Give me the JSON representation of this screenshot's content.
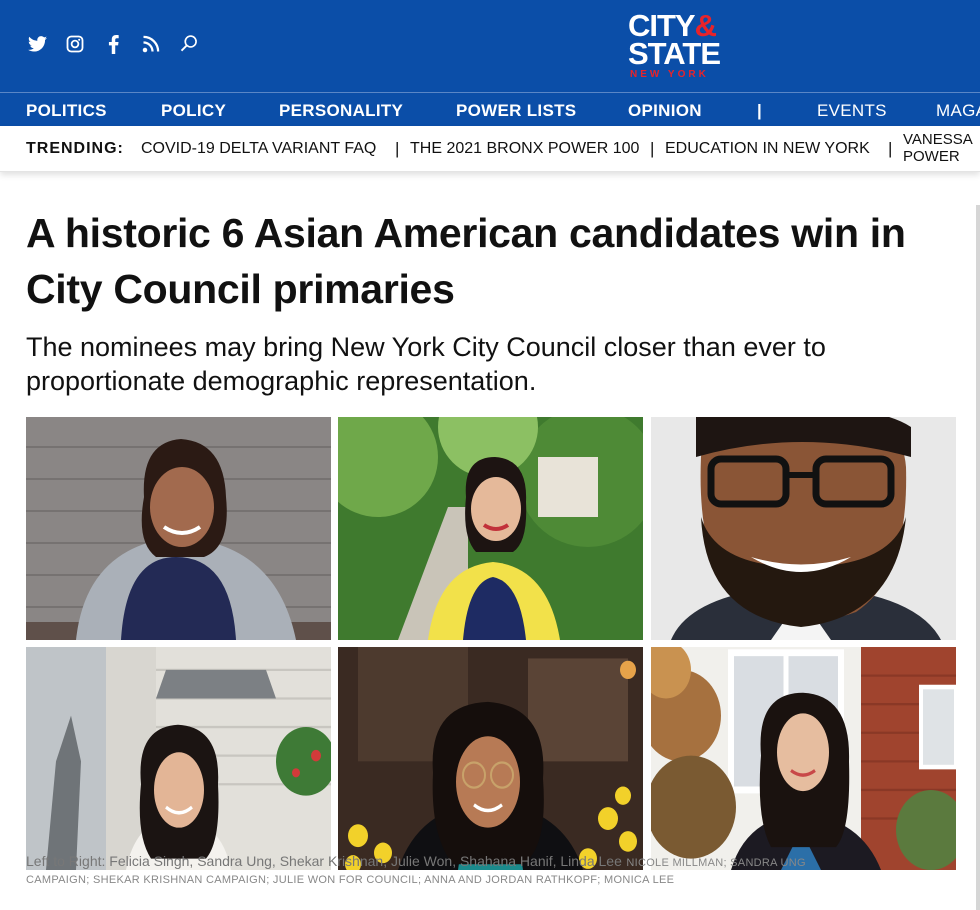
{
  "header": {
    "social_icons": [
      "twitter-icon",
      "instagram-icon",
      "facebook-icon",
      "rss-icon",
      "search-icon"
    ],
    "logo": {
      "line1": "CITY",
      "amp": "&",
      "line2": "STATE",
      "line3": "NEW YORK"
    },
    "colors": {
      "brand_blue": "#0b4ea8",
      "brand_red": "#e8232a"
    }
  },
  "nav": {
    "items": [
      "POLITICS",
      "POLICY",
      "PERSONALITY",
      "POWER LISTS",
      "OPINION",
      "|",
      "EVENTS",
      "MAGA"
    ]
  },
  "trending": {
    "label": "TRENDING:",
    "items": [
      "COVID-19 DELTA VARIANT FAQ",
      "THE 2021 BRONX POWER 100",
      "EDUCATION IN NEW YORK"
    ],
    "separator": "|",
    "last_line1": "VANESSA",
    "last_line2": "POWER"
  },
  "article": {
    "headline": "A historic 6 Asian American candidates win in City Council primaries",
    "dek": "The nominees may bring New York City Council closer than ever to proportionate demographic representation.",
    "caption": "Left to Right: Felicia Singh, Sandra Ung, Shekar Krishnan, Julie Won, Shahana Hanif, Linda Lee",
    "credit_line1": "NICOLE MILLMAN; SANDRA UNG",
    "credit_line2": "CAMPAIGN; SHEKAR KRISHNAN CAMPAIGN; JULIE WON FOR COUNCIL; ANNA AND JORDAN RATHKOPF; MONICA LEE"
  }
}
